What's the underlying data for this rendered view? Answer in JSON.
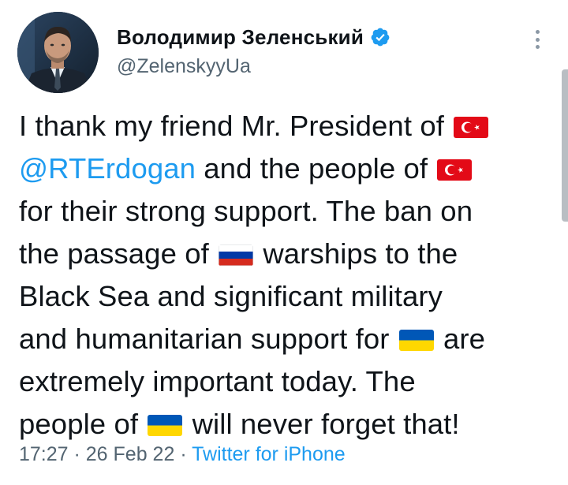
{
  "author": {
    "name": "Володимир Зеленський",
    "handle": "@ZelenskyyUa",
    "verified_icon": "verified-badge-icon",
    "avatar": "profile-photo"
  },
  "tweet": {
    "line1_text": "I thank my friend Mr. President of ",
    "line1_flag": "turkey-flag",
    "line2_mention": "@RTErdogan",
    "line2_text": " and the people of ",
    "line2_flag": "turkey-flag",
    "line3_text": "for their strong support. The ban on",
    "line4_text_a": "the passage of ",
    "line4_flag": "russia-flag",
    "line4_text_b": " warships to the",
    "line5_text": "Black Sea and significant military",
    "line6_text_a": "and humanitarian support for ",
    "line6_flag": "ukraine-flag",
    "line6_text_b": " are",
    "line7_text": "extremely important today. The",
    "line8_text_a": "people of ",
    "line8_flag": "ukraine-flag",
    "line8_text_b": " will never forget that!"
  },
  "meta": {
    "time": "17:27",
    "separator1": " · ",
    "date": "26 Feb 22",
    "separator2": " · ",
    "source": "Twitter for iPhone"
  },
  "colors": {
    "link": "#1d9bf0",
    "secondary_text": "#536471",
    "primary_text": "#0f1419",
    "turkey_red": "#e30a17",
    "ukraine_blue": "#0057b7",
    "ukraine_yellow": "#ffd700",
    "russia_white": "#ffffff",
    "russia_blue": "#0039a6",
    "russia_red": "#d52b1e"
  }
}
